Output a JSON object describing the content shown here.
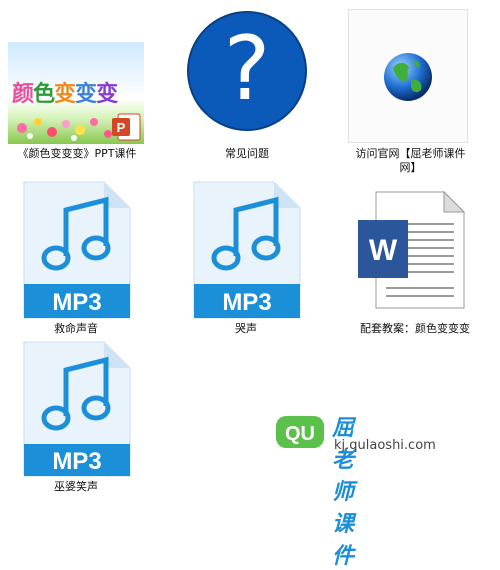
{
  "files": [
    {
      "label": "《颜色变变变》PPT课件",
      "thumb_title": [
        "颜",
        "色",
        "变",
        "变",
        "变"
      ],
      "badge": "P"
    },
    {
      "label": "常见问题",
      "mark": "?"
    },
    {
      "label": "访问官网【屈老师课件网】"
    },
    {
      "label": "救命声音",
      "badge": "MP3"
    },
    {
      "label": "哭声",
      "badge": "MP3"
    },
    {
      "label": "配套教案：颜色变变变",
      "badge": "W"
    },
    {
      "label": "巫婆笑声",
      "badge": "MP3"
    }
  ],
  "watermark": {
    "logo_text": "QU",
    "brand": "屈老师课件",
    "domain": "kj.qulaoshi.com"
  },
  "colors": {
    "mp3_blue": "#1b8fd8",
    "word_blue": "#2b579a",
    "ppt_orange": "#d24726",
    "help_blue": "#0b59b8",
    "logo_green": "#5cc14a"
  },
  "icons": [
    "powerpoint-file-icon",
    "help-icon",
    "globe-icon",
    "mp3-file-icon",
    "word-file-icon",
    "watermark-logo"
  ]
}
